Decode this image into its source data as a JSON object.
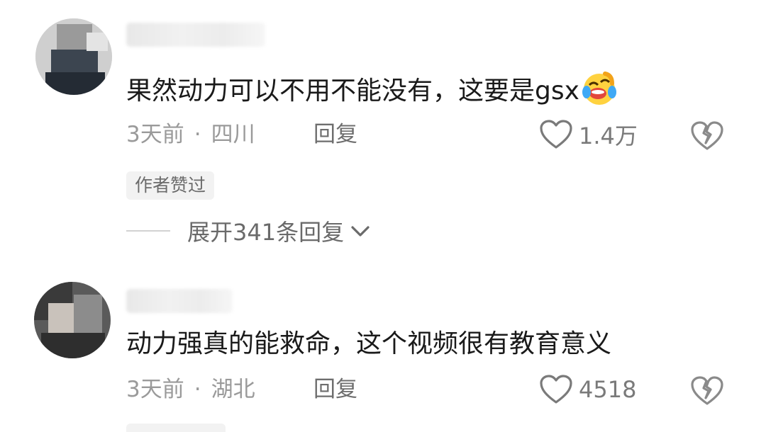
{
  "comments": [
    {
      "text": "果然动力可以不用不能没有，这要是gsx",
      "emoji": "rofl-emoji",
      "time": "3天前",
      "location": "四川",
      "reply_label": "回复",
      "likes": "1.4万",
      "author_liked_badge": "作者赞过",
      "expand_replies": "展开341条回复"
    },
    {
      "text": "动力强真的能救命，这个视频很有教育意义",
      "time": "3天前",
      "location": "湖北",
      "reply_label": "回复",
      "likes": "4518"
    }
  ],
  "meta_separator": "·",
  "icons": {
    "like": "heart-outline-icon",
    "dislike": "broken-heart-icon",
    "expand": "chevron-down-icon"
  },
  "colors": {
    "text": "#1a1a1a",
    "meta": "#9a9a9a",
    "badge_bg": "#f2f2f2"
  }
}
